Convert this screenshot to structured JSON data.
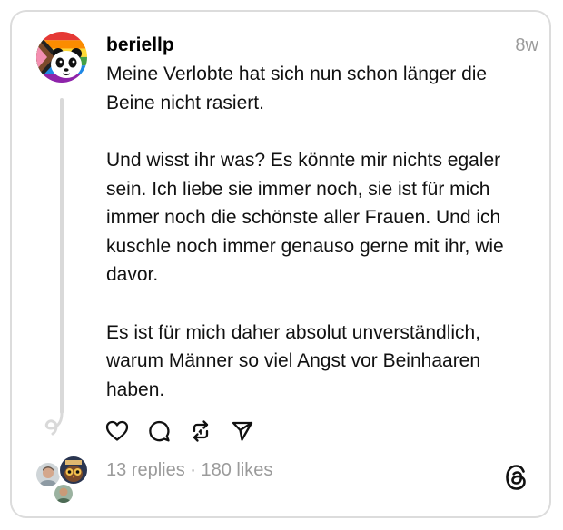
{
  "post": {
    "username": "beriellp",
    "timestamp": "8w",
    "paragraphs": [
      "Meine Verlobte hat sich nun schon länger die Beine nicht rasiert.",
      "Und wisst ihr was? Es könnte mir nichts egaler sein. Ich liebe sie immer noch, sie ist für mich immer noch die schönste aller Frauen. Und ich kuschle noch immer genauso gerne mit ihr, wie davor.",
      "Es ist für mich daher absolut unverständlich, warum Männer so viel Angst vor Beinhaaren haben."
    ],
    "stats": "13 replies · 180 likes"
  },
  "icons": {
    "like": "heart-icon",
    "reply": "comment-icon",
    "repost": "repost-icon",
    "share": "send-icon",
    "app": "threads-logo-icon"
  },
  "colors": {
    "text": "#111111",
    "muted": "#9b9b9b",
    "border": "#dcdcdc",
    "thread_line": "#d9d9d9"
  }
}
